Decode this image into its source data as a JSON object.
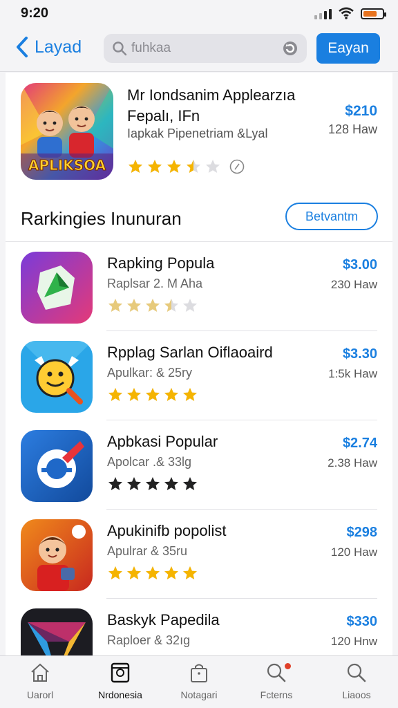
{
  "status": {
    "time": "9:20"
  },
  "header": {
    "back_label": "Layad",
    "search_text": "fuhkaa",
    "action_label": "Eayan"
  },
  "featured": {
    "title": "Mr Iondsanim Applearzıa Fepalı, IFn",
    "developer": "Iapkak Pipenetriam &Lyal",
    "price": "$210",
    "count": "128 Haw",
    "rating": 3.5,
    "icon": "promo-artwork",
    "art_text": "APLIKSOA"
  },
  "section": {
    "title": "Rarkingies Inunuran",
    "button_label": "Betvantm"
  },
  "apps": [
    {
      "name": "Rapking Popula",
      "sub": "Raplsar 2. M Aha",
      "price": "$3.00",
      "count": "230 Haw",
      "rating": 3.5,
      "star_color": "#f5b400",
      "star_faded": true,
      "icon": "map-app-icon"
    },
    {
      "name": "Rpplag Sarlan Oiflaoaird",
      "sub": "Apulkar: & 25ry",
      "price": "$3.30",
      "count": "1:5k Haw",
      "rating": 5,
      "star_color": "#f5b400",
      "star_faded": false,
      "icon": "smiley-app-icon"
    },
    {
      "name": "Apbkasi Popular",
      "sub": "Apolcar .& 33lg",
      "price": "$2.74",
      "count": "2.38 Haw",
      "rating": 5,
      "star_color": "#222222",
      "star_faded": false,
      "icon": "swirl-app-icon"
    },
    {
      "name": "Apukinifb popolist",
      "sub": "Apulrar & 35ru",
      "price": "$298",
      "count": "120 Haw",
      "rating": 5,
      "star_color": "#f5b400",
      "star_faded": false,
      "icon": "cartoon-app-icon"
    },
    {
      "name": "Baskyk Papedila",
      "sub": "Raploer & 32ıg",
      "price": "$330",
      "count": "120 Hnw",
      "rating": 5,
      "star_color": "#f5b400",
      "star_faded": true,
      "icon": "arrow-app-icon"
    }
  ],
  "tabs": [
    {
      "label": "Uarorl",
      "icon": "home-icon",
      "active": false
    },
    {
      "label": "Nrdonesia",
      "icon": "apps-icon",
      "active": true
    },
    {
      "label": "Notagari",
      "icon": "bag-icon",
      "active": false
    },
    {
      "label": "Fcterns",
      "icon": "search-badge-icon",
      "active": false
    },
    {
      "label": "Liaoos",
      "icon": "search-icon",
      "active": false
    }
  ],
  "colors": {
    "accent": "#1a7fe0",
    "star": "#f5b400"
  }
}
